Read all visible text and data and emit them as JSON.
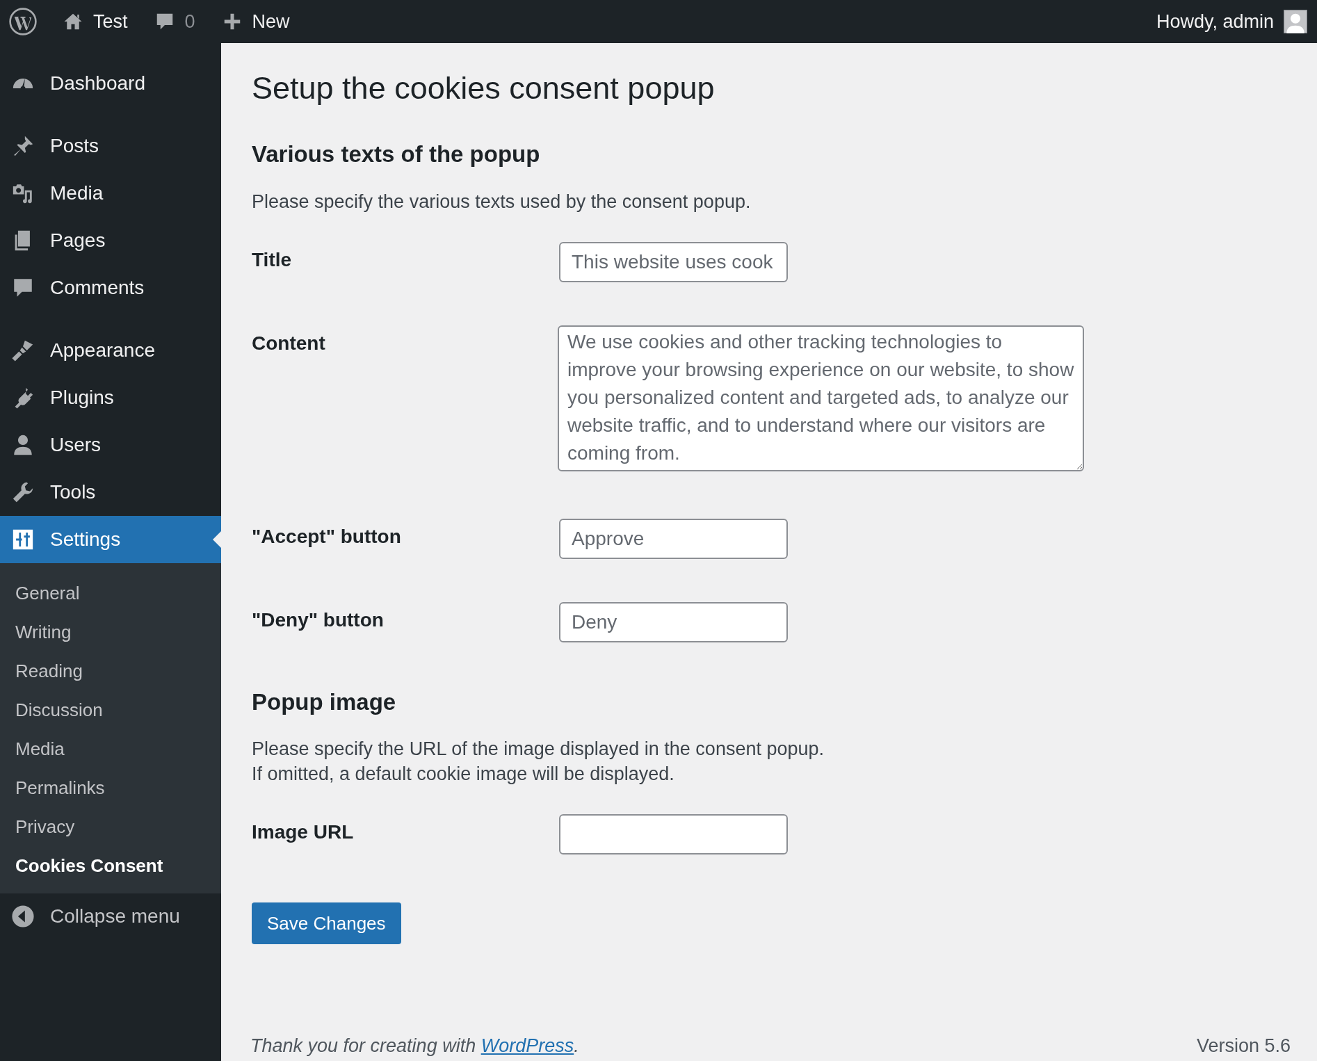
{
  "admin_bar": {
    "site_name": "Test",
    "comments_count": "0",
    "new_label": "New",
    "greeting": "Howdy, admin"
  },
  "sidebar": {
    "items": [
      {
        "label": "Dashboard",
        "selected": false,
        "separator_before": false
      },
      {
        "label": "Posts",
        "selected": false,
        "separator_before": true
      },
      {
        "label": "Media",
        "selected": false,
        "separator_before": false
      },
      {
        "label": "Pages",
        "selected": false,
        "separator_before": false
      },
      {
        "label": "Comments",
        "selected": false,
        "separator_before": false
      },
      {
        "label": "Appearance",
        "selected": false,
        "separator_before": true
      },
      {
        "label": "Plugins",
        "selected": false,
        "separator_before": false
      },
      {
        "label": "Users",
        "selected": false,
        "separator_before": false
      },
      {
        "label": "Tools",
        "selected": false,
        "separator_before": false
      },
      {
        "label": "Settings",
        "selected": true,
        "separator_before": false
      }
    ],
    "submenu": [
      {
        "label": "General",
        "selected": false
      },
      {
        "label": "Writing",
        "selected": false
      },
      {
        "label": "Reading",
        "selected": false
      },
      {
        "label": "Discussion",
        "selected": false
      },
      {
        "label": "Media",
        "selected": false
      },
      {
        "label": "Permalinks",
        "selected": false
      },
      {
        "label": "Privacy",
        "selected": false
      },
      {
        "label": "Cookies Consent",
        "selected": true
      }
    ],
    "collapse_label": "Collapse menu"
  },
  "page": {
    "title": "Setup the cookies consent popup",
    "sections": [
      {
        "heading": "Various texts of the popup",
        "description": [
          "Please specify the various texts used by the consent popup."
        ],
        "fields": [
          {
            "label": "Title",
            "kind": "text",
            "placeholder": "This website uses cook"
          },
          {
            "label": "Content",
            "kind": "textarea",
            "placeholder": "We use cookies and other tracking technologies to improve your browsing experience on our website, to show you personalized content and targeted ads, to analyze our website traffic, and to understand where our visitors are coming from."
          },
          {
            "label": "\"Accept\" button",
            "kind": "text",
            "placeholder": "Approve"
          },
          {
            "label": "\"Deny\" button",
            "kind": "text",
            "placeholder": "Deny"
          }
        ]
      },
      {
        "heading": "Popup image",
        "description": [
          "Please specify the URL of the image displayed in the consent popup.",
          "If omitted, a default cookie image will be displayed."
        ],
        "fields": [
          {
            "label": "Image URL",
            "kind": "text"
          }
        ]
      }
    ],
    "save_button": "Save Changes"
  },
  "footer": {
    "text": "Thank you for creating with ",
    "link": "WordPress",
    "text_after": ".",
    "version": "Version 5.6"
  }
}
